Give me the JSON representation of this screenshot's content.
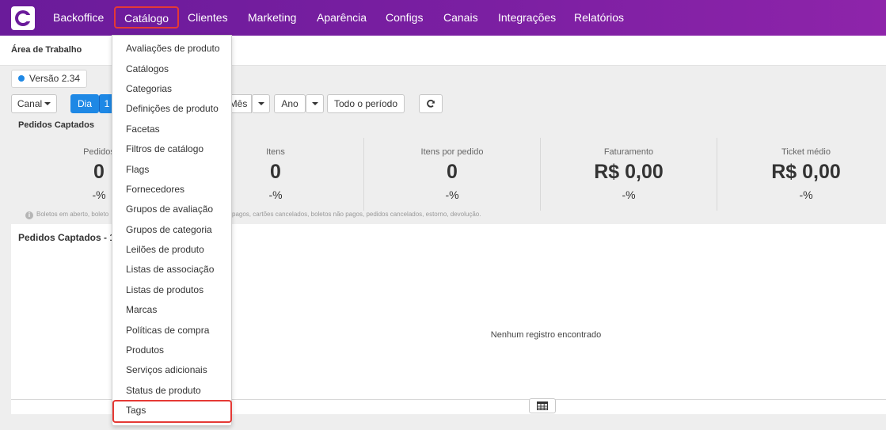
{
  "nav": {
    "items": [
      "Backoffice",
      "Catálogo",
      "Clientes",
      "Marketing",
      "Aparência",
      "Configs",
      "Canais",
      "Integrações",
      "Relatórios"
    ]
  },
  "workspace": {
    "title": "Área de Trabalho"
  },
  "version": {
    "label": "Versão 2.34"
  },
  "filters": {
    "channel": "Canal",
    "day": "Dia",
    "day_partial": "1",
    "month": "Mês",
    "year": "Ano",
    "all_period": "Todo o período"
  },
  "summary": {
    "title": "Pedidos Captados",
    "stats": [
      {
        "label": "Pedidos",
        "value": "0",
        "pct": "-%"
      },
      {
        "label": "Itens",
        "value": "0",
        "pct": "-%"
      },
      {
        "label": "Itens por pedido",
        "value": "0",
        "pct": "-%"
      },
      {
        "label": "Faturamento",
        "value": "R$ 0,00",
        "pct": "-%"
      },
      {
        "label": "Ticket médio",
        "value": "R$ 0,00",
        "pct": "-%"
      }
    ],
    "note_left": "Boletos em aberto, boleto",
    "note_right": "pagos, cartões cancelados, boletos não pagos, pedidos cancelados, estorno, devolução."
  },
  "panel": {
    "title": "Pedidos Captados - 19",
    "empty": "Nenhum registro encontrado"
  },
  "catalog_menu": {
    "items": [
      "Avaliações de produto",
      "Catálogos",
      "Categorias",
      "Definições de produto",
      "Facetas",
      "Filtros de catálogo",
      "Flags",
      "Fornecedores",
      "Grupos de avaliação",
      "Grupos de categoria",
      "Leilões de produto",
      "Listas de associação",
      "Listas de produtos",
      "Marcas",
      "Políticas de compra",
      "Produtos",
      "Serviços adicionais",
      "Status de produto",
      "Tags"
    ]
  },
  "colors": {
    "nav_gradient_start": "#6a1b9a",
    "nav_gradient_end": "#8e24aa",
    "highlight": "#e53935",
    "primary": "#1e88e5"
  }
}
